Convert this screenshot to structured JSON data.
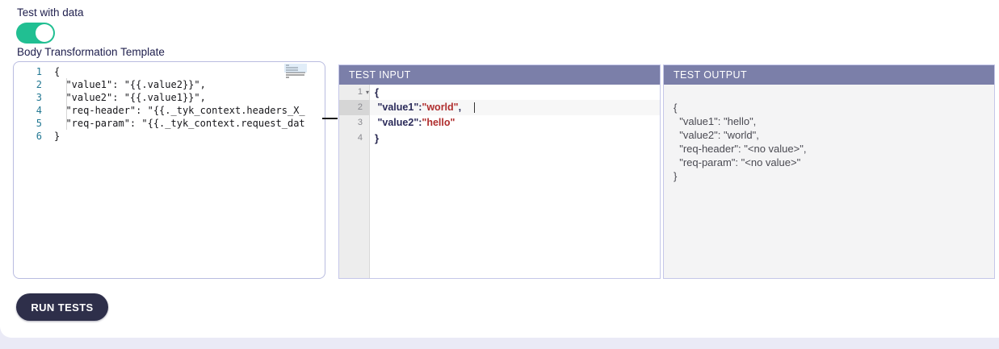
{
  "controls": {
    "toggle_label": "Test with data",
    "toggle_state": "on",
    "template_label": "Body Transformation Template",
    "run_tests_label": "RUN TESTS"
  },
  "template_editor": {
    "lines": [
      {
        "num": "1",
        "code": "{"
      },
      {
        "num": "2",
        "code": "  \"value1\": \"{{.value2}}\","
      },
      {
        "num": "3",
        "code": "  \"value2\": \"{{.value1}}\","
      },
      {
        "num": "4",
        "code": "  \"req-header\": \"{{._tyk_context.headers_X_"
      },
      {
        "num": "5",
        "code": "  \"req-param\": \"{{._tyk_context.request_dat"
      },
      {
        "num": "6",
        "code": "}"
      }
    ]
  },
  "test_input": {
    "header": "TEST INPUT",
    "fold_arrow": "▾",
    "lines": [
      {
        "num": "1",
        "pre": "{",
        "value": "",
        "post": ""
      },
      {
        "num": "2",
        "pre": " \"value1\":",
        "value": "\"world\"",
        "post": ","
      },
      {
        "num": "3",
        "pre": " \"value2\":",
        "value": "\"hello\"",
        "post": ""
      },
      {
        "num": "4",
        "pre": "}",
        "value": "",
        "post": ""
      }
    ]
  },
  "test_output": {
    "header": "TEST OUTPUT",
    "lines": [
      "{",
      "  \"value1\": \"hello\",",
      "  \"value2\": \"world\",",
      "  \"req-header\": \"<no value>\",",
      "  \"req-param\": \"<no value>\"",
      "}"
    ]
  },
  "colors": {
    "accent_green": "#21bf92",
    "panel_header_bg": "#7b7fa9",
    "button_bg": "#2e2f4a",
    "string_red": "#b02e2e",
    "line_number_blue": "#237893",
    "page_background": "#eaeaf6"
  }
}
